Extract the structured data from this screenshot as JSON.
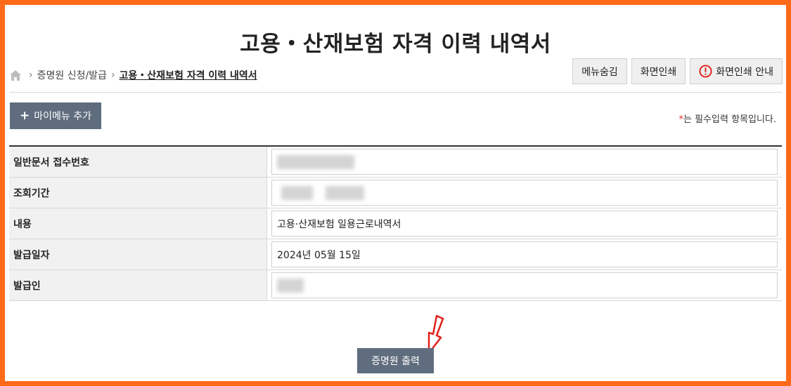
{
  "page": {
    "title": "고용・산재보험 자격 이력 내역서"
  },
  "breadcrumb": {
    "home_icon": "home-icon",
    "items": [
      "증명원 신청/발급",
      "고용・산재보험 자격 이력 내역서"
    ]
  },
  "top_buttons": {
    "hide_menu": "메뉴숨김",
    "print_screen": "화면인쇄",
    "print_guide": "화면인쇄 안내"
  },
  "mymenu": {
    "label": "마이메뉴 추가"
  },
  "required_note": {
    "star": "*",
    "text": "는 필수입력 항목입니다."
  },
  "table": {
    "rows": [
      {
        "label": "일반문서 접수번호",
        "value": ""
      },
      {
        "label": "조회기간",
        "value": ""
      },
      {
        "label": "내용",
        "value": "고용·산재보험 일용근로내역서"
      },
      {
        "label": "발급일자",
        "value": "2024년 05월 15일"
      },
      {
        "label": "발급인",
        "value": ""
      }
    ]
  },
  "actions": {
    "print_certificate": "증명원 출력"
  },
  "colors": {
    "frame_border": "#ff6a1a",
    "button_dark": "#5f6d7e",
    "arrow": "#e0201a",
    "required_star": "#e0322a"
  }
}
